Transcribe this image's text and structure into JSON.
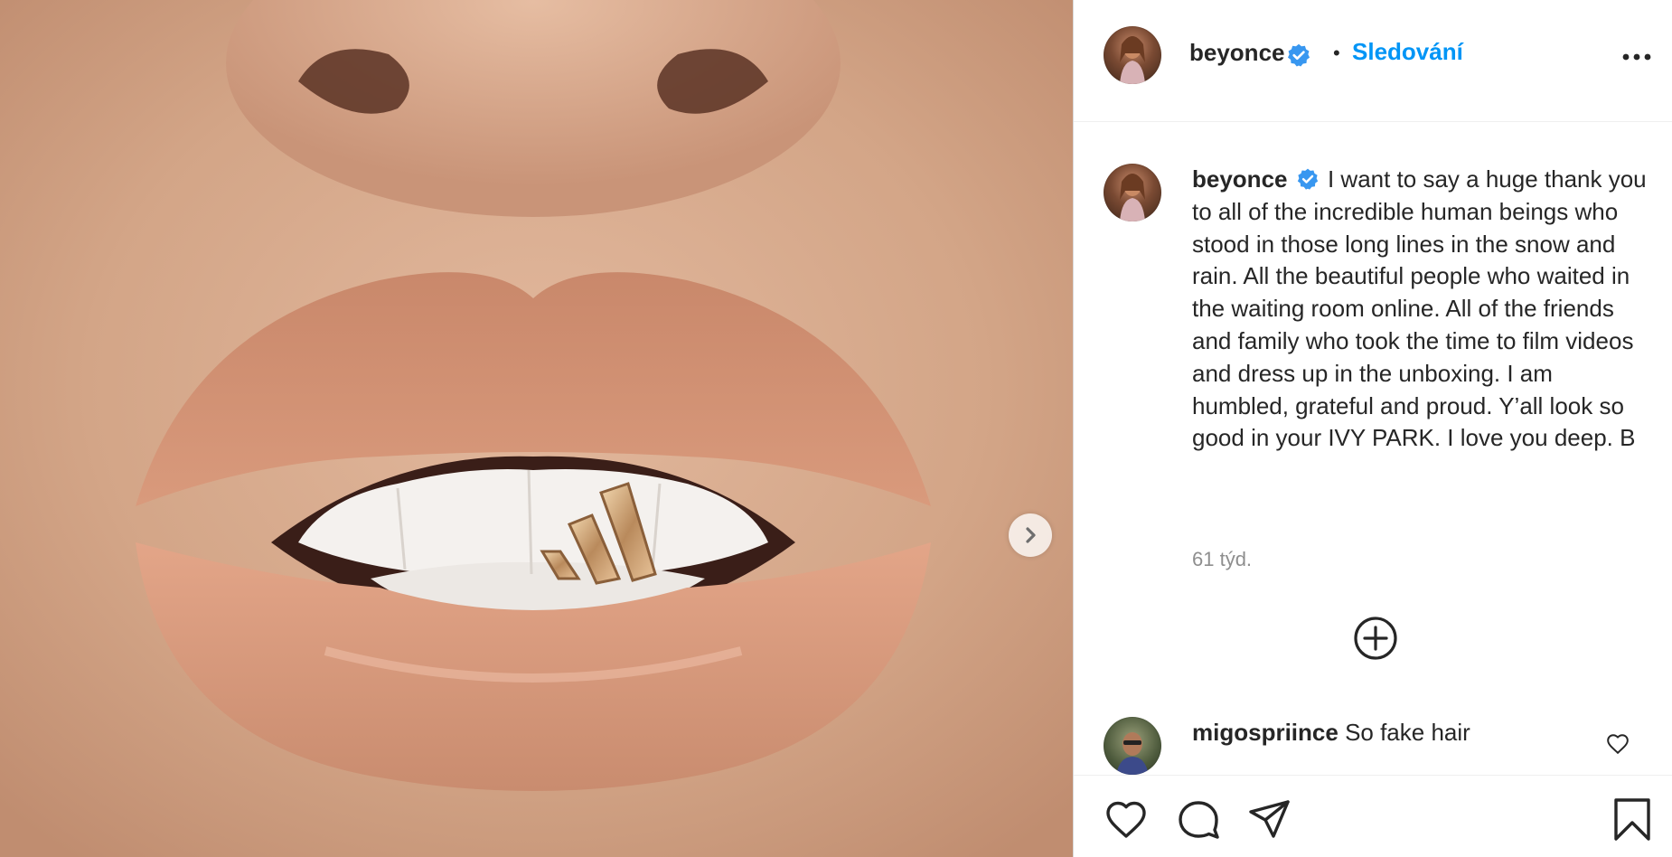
{
  "post": {
    "author": "beyonce",
    "verified": true,
    "follow_status": "Sledování",
    "separator": "•",
    "caption": "I want to say a huge thank you to all of the incredible human beings who stood in those long lines in the snow and rain. All the beautiful people who waited in the waiting room online. All of the friends and family who took the time to film videos and dress up in the unboxing. I am humbled, grateful and proud. Y’all look so good in your IVY PARK. I love you deep. B",
    "time_ago": "61 týd."
  },
  "comments": [
    {
      "user": "migospriince",
      "text": "So fake hair"
    }
  ],
  "icons": {
    "verified": "verified-badge-icon",
    "more": "more-options-icon",
    "next": "chevron-right-icon",
    "load_more": "plus-circle-icon",
    "like": "heart-icon",
    "comment": "comment-bubble-icon",
    "share": "paper-plane-icon",
    "save": "bookmark-icon"
  },
  "colors": {
    "accent": "#0095f6",
    "verified": "#3897f0",
    "text": "#262626",
    "muted": "#8e8e8e"
  }
}
